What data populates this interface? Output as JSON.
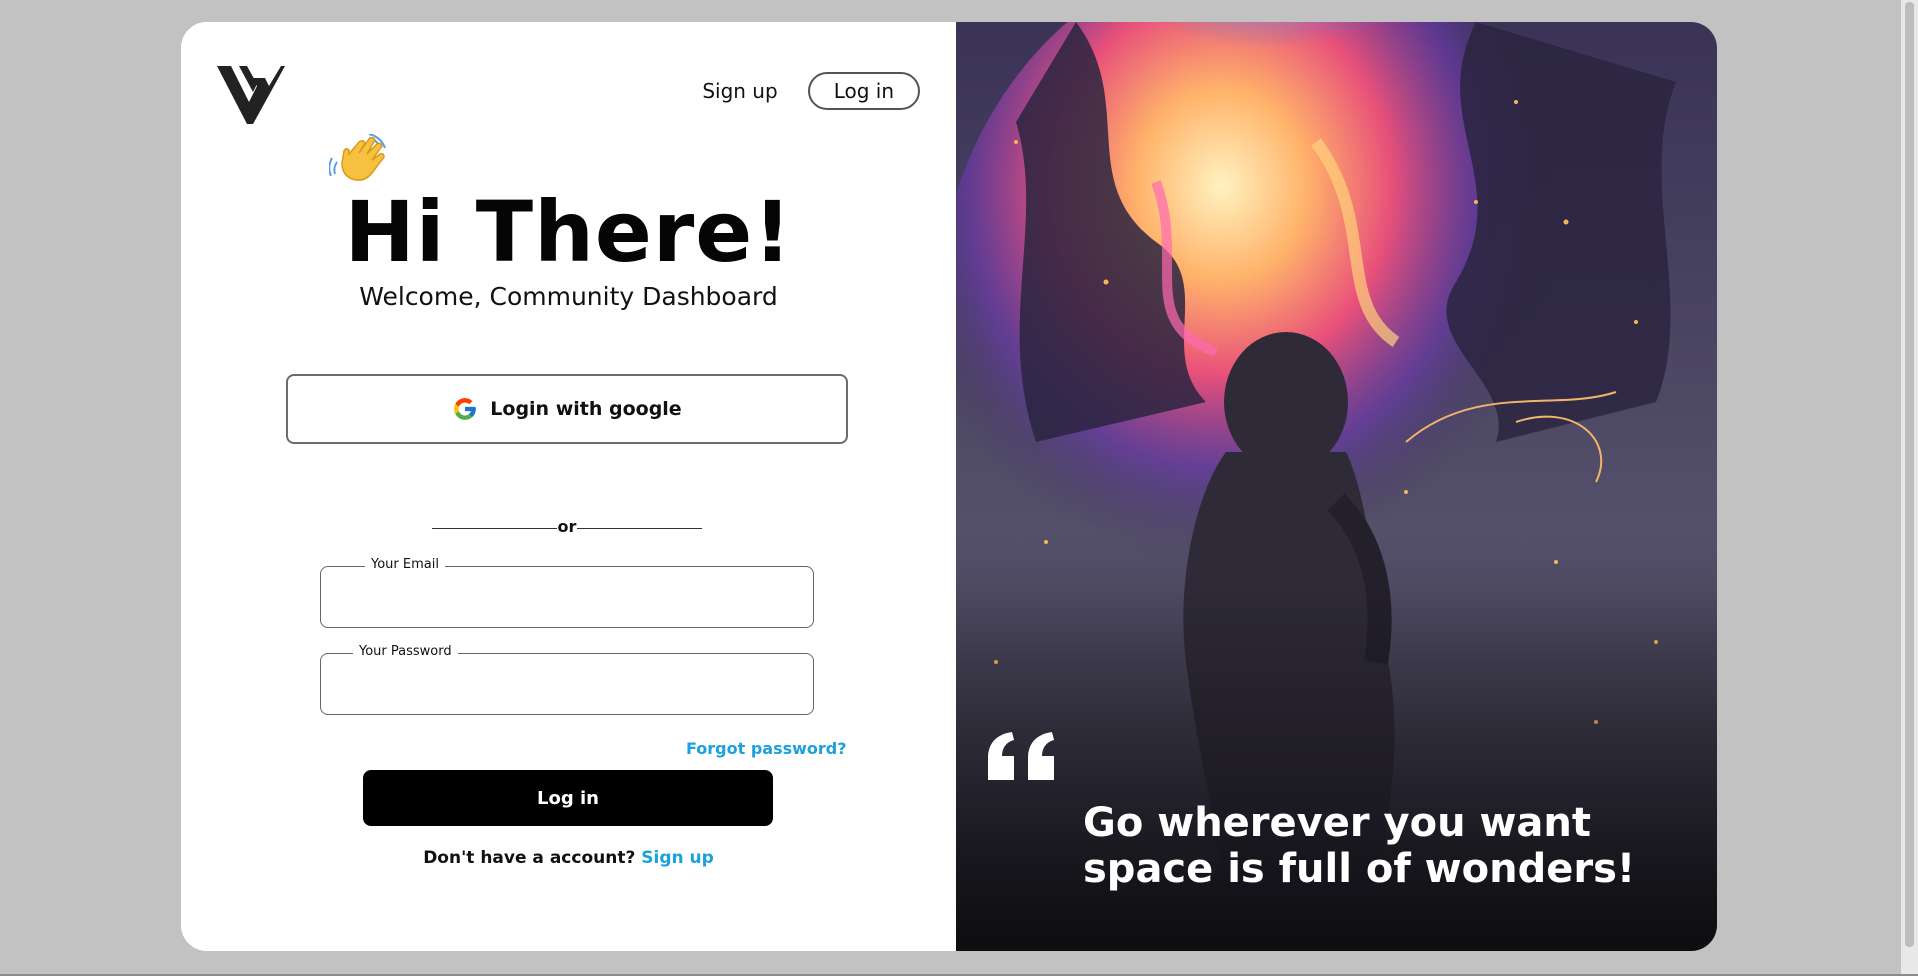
{
  "nav": {
    "signup_label": "Sign up",
    "login_label": "Log in"
  },
  "hero": {
    "title": "Hi There!",
    "subtitle": "Welcome, Community Dashboard"
  },
  "auth": {
    "google_label": "Login with google",
    "divider_text": "or",
    "email_label": "Your Email",
    "email_value": "",
    "password_label": "Your Password",
    "password_value": "",
    "forgot_label": "Forgot password?",
    "login_label": "Log in",
    "no_account_text": "Don't have a account?",
    "signup_link": "Sign up"
  },
  "quote": {
    "line1": "Go wherever you want",
    "line2": "space is full of wonders!"
  },
  "colors": {
    "page_bg": "#c2c2c2",
    "card_bg": "#ffffff",
    "primary_button": "#000000",
    "link": "#1da1dc"
  },
  "icons": {
    "logo": "brand-logo",
    "wave": "waving-hand-icon",
    "google": "google-icon",
    "quote": "quote-mark-icon"
  }
}
